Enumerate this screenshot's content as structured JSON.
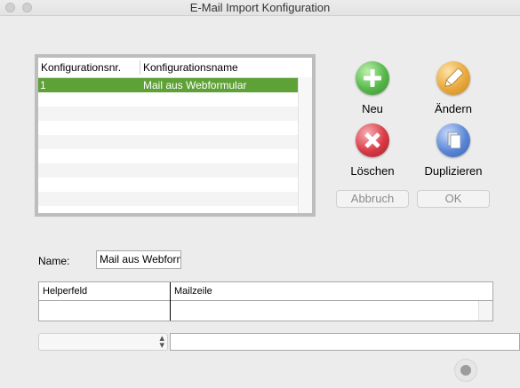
{
  "window": {
    "title": "E-Mail Import Konfiguration"
  },
  "config_list": {
    "columns": [
      "Konfigurationsnr.",
      "Konfigurationsname"
    ],
    "rows": [
      {
        "nr": "1",
        "name": "Mail aus Webformular",
        "selected": true
      }
    ],
    "selected_color": "#5ea137"
  },
  "actions": {
    "new_label": "Neu",
    "edit_label": "Ändern",
    "delete_label": "Löschen",
    "duplicate_label": "Duplizieren",
    "cancel_label": "Abbruch",
    "ok_label": "OK"
  },
  "form": {
    "name_label": "Name:",
    "name_value": "Mail aus Webform"
  },
  "mapping_table": {
    "columns": [
      "Helperfeld",
      "Mailzeile"
    ]
  },
  "colors": {
    "new": "#57b84a",
    "edit": "#e8a93c",
    "delete": "#d93a45",
    "duplicate": "#5b86d6"
  }
}
